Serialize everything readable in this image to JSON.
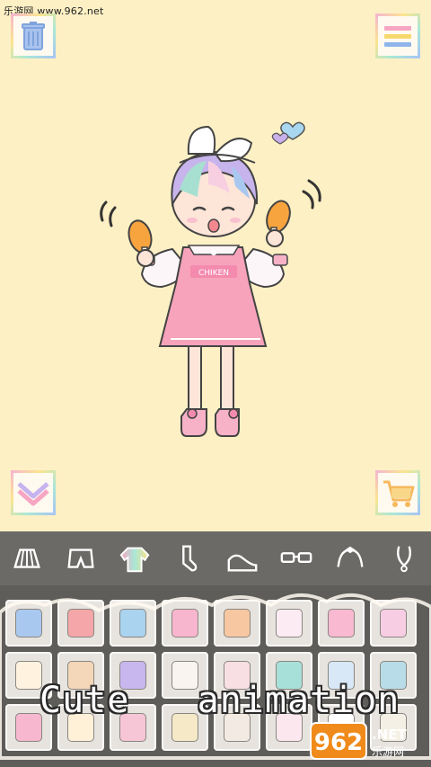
{
  "watermark": "乐游网 www.962.net",
  "banner": {
    "word1": "Cute",
    "word2": "animation"
  },
  "logo": {
    "text": "962.NET",
    "subtext": "乐游网"
  },
  "toolbar": {
    "categories": [
      "skirt",
      "shorts",
      "top",
      "socks",
      "shoes",
      "glasses",
      "headband",
      "accessory"
    ],
    "selected": "top"
  },
  "character": {
    "shirt_text": "CHIKEN"
  },
  "colors": {
    "background": "#fdf0c4",
    "toolbar": "#6c6a66",
    "panel": "#5f5d5a",
    "dress": "#f6a3bb"
  },
  "wardrobe_items": [
    "#a9c8ef",
    "#f4a6a8",
    "#a9d3ef",
    "#f7b6cd",
    "#f6c7a1",
    "#fdebf3",
    "#f9b9d1",
    "#f7cde4",
    "#fff3e0",
    "#f3d7b8",
    "#c7b7ee",
    "#f9f4f0",
    "#f8dfe3",
    "#a7e0d9",
    "#d8e8f6",
    "#b8dde8",
    "#f7b8cf",
    "#fff0d8",
    "#f7c6d6",
    "#f5e9c7",
    "#f3ebe3",
    "#fde7ee",
    "#fff",
    "#f5f0e5"
  ]
}
